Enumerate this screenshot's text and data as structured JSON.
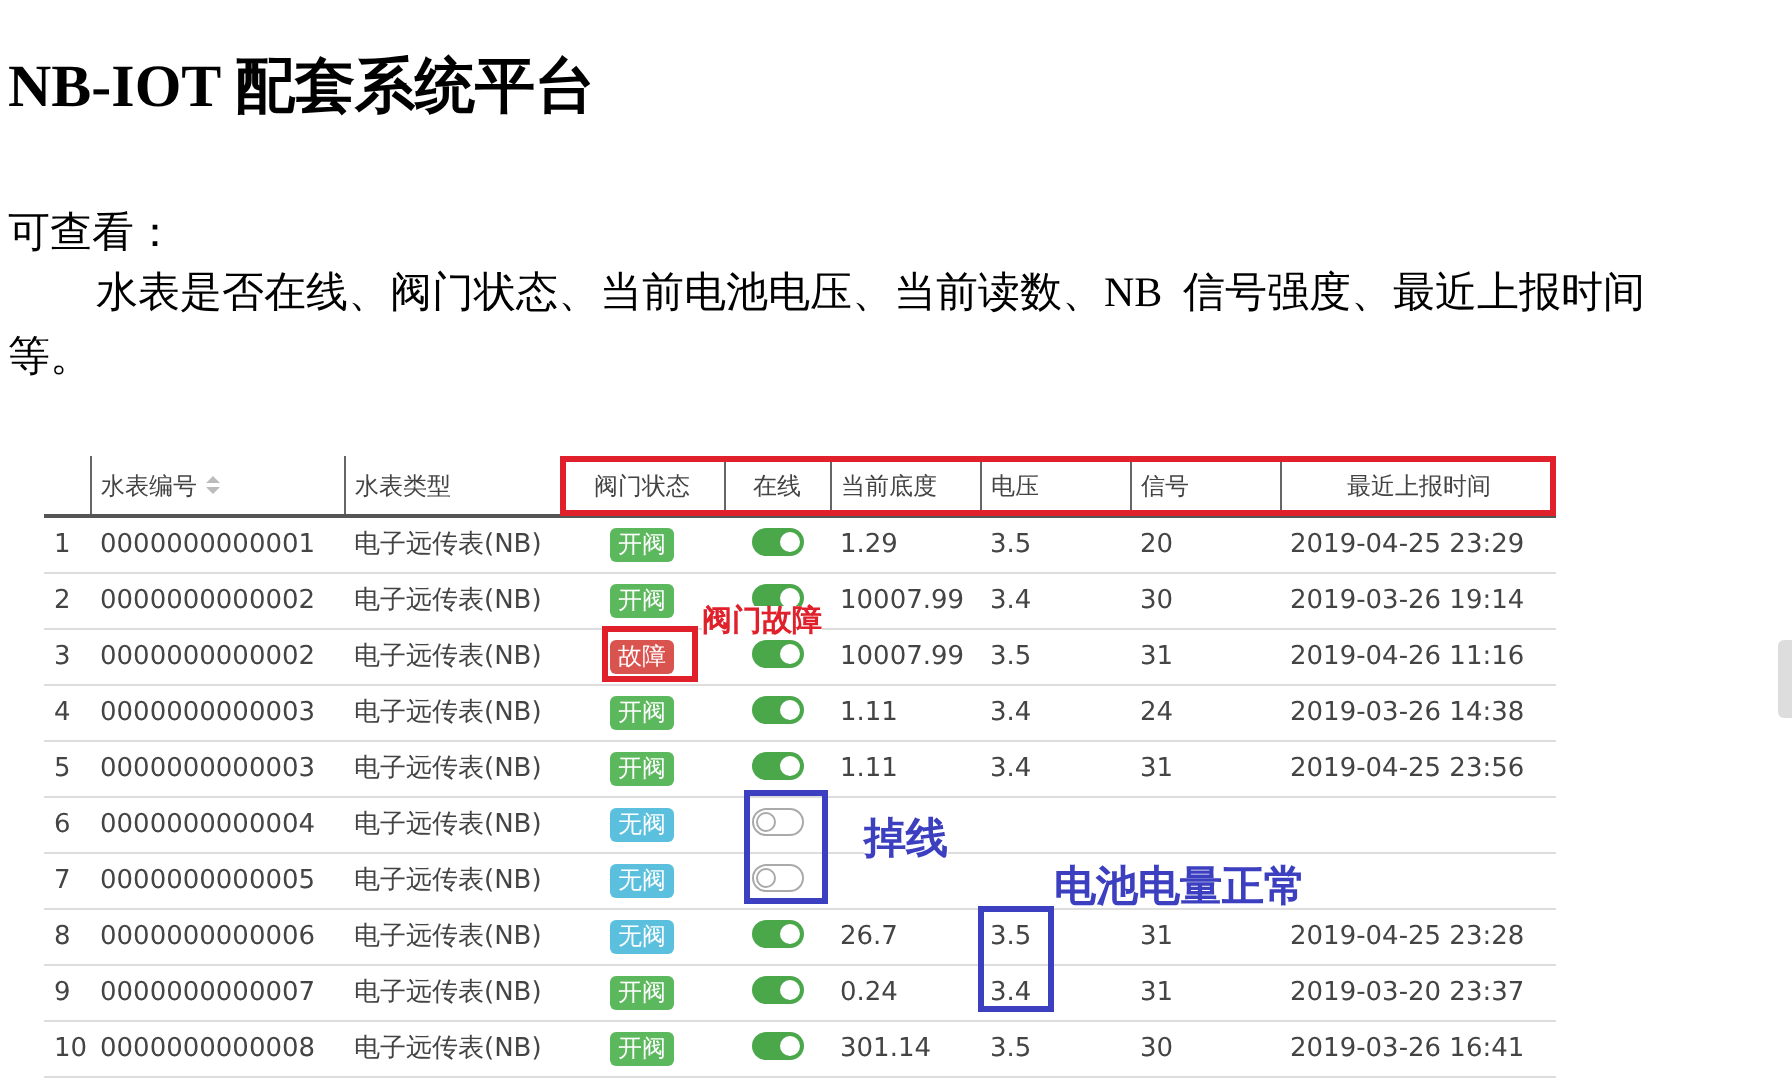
{
  "heading": "NB-IOT 配套系统平台",
  "subheading": "可查看：",
  "paragraph": "水表是否在线、阀门状态、当前电池电压、当前读数、NB  信号强度、最近上报时间等。",
  "table": {
    "columns": [
      {},
      {
        "label": "水表编号",
        "sortable": true
      },
      {
        "label": "水表类型"
      },
      {
        "label": "阀门状态"
      },
      {
        "label": "在线"
      },
      {
        "label": "当前底度"
      },
      {
        "label": "电压"
      },
      {
        "label": "信号"
      },
      {
        "label": "最近上报时间"
      }
    ],
    "rows": [
      {
        "index": "1",
        "id": "0000000000001",
        "type": "电子远传表(NB)",
        "valve": {
          "label": "开阀",
          "kind": "open"
        },
        "online": true,
        "reading": "1.29",
        "voltage": "3.5",
        "signal": "20",
        "time": "2019-04-25 23:29"
      },
      {
        "index": "2",
        "id": "0000000000002",
        "type": "电子远传表(NB)",
        "valve": {
          "label": "开阀",
          "kind": "open"
        },
        "online": true,
        "reading": "10007.99",
        "voltage": "3.4",
        "signal": "30",
        "time": "2019-03-26 19:14"
      },
      {
        "index": "3",
        "id": "0000000000002",
        "type": "电子远传表(NB)",
        "valve": {
          "label": "故障",
          "kind": "fault"
        },
        "online": true,
        "reading": "10007.99",
        "voltage": "3.5",
        "signal": "31",
        "time": "2019-04-26 11:16"
      },
      {
        "index": "4",
        "id": "0000000000003",
        "type": "电子远传表(NB)",
        "valve": {
          "label": "开阀",
          "kind": "open"
        },
        "online": true,
        "reading": "1.11",
        "voltage": "3.4",
        "signal": "24",
        "time": "2019-03-26 14:38"
      },
      {
        "index": "5",
        "id": "0000000000003",
        "type": "电子远传表(NB)",
        "valve": {
          "label": "开阀",
          "kind": "open"
        },
        "online": true,
        "reading": "1.11",
        "voltage": "3.4",
        "signal": "31",
        "time": "2019-04-25 23:56"
      },
      {
        "index": "6",
        "id": "0000000000004",
        "type": "电子远传表(NB)",
        "valve": {
          "label": "无阀",
          "kind": "none"
        },
        "online": false,
        "reading": "",
        "voltage": "",
        "signal": "",
        "time": ""
      },
      {
        "index": "7",
        "id": "0000000000005",
        "type": "电子远传表(NB)",
        "valve": {
          "label": "无阀",
          "kind": "none"
        },
        "online": false,
        "reading": "",
        "voltage": "",
        "signal": "",
        "time": ""
      },
      {
        "index": "8",
        "id": "0000000000006",
        "type": "电子远传表(NB)",
        "valve": {
          "label": "无阀",
          "kind": "none"
        },
        "online": true,
        "reading": "26.7",
        "voltage": "3.5",
        "signal": "31",
        "time": "2019-04-25 23:28"
      },
      {
        "index": "9",
        "id": "0000000000007",
        "type": "电子远传表(NB)",
        "valve": {
          "label": "开阀",
          "kind": "open"
        },
        "online": true,
        "reading": "0.24",
        "voltage": "3.4",
        "signal": "31",
        "time": "2019-03-20 23:37"
      },
      {
        "index": "10",
        "id": "0000000000008",
        "type": "电子远传表(NB)",
        "valve": {
          "label": "开阀",
          "kind": "open"
        },
        "online": true,
        "reading": "301.14",
        "voltage": "3.5",
        "signal": "30",
        "time": "2019-03-26 16:41"
      }
    ]
  },
  "annotations": [
    {
      "kind": "box",
      "color": "#e0202a"
    },
    {
      "kind": "box",
      "color": "#e0202a"
    },
    {
      "kind": "label",
      "text": "阀门故障",
      "color": "#e0202a"
    },
    {
      "kind": "box",
      "color": "#3b3fc0"
    },
    {
      "kind": "label",
      "text": "掉线",
      "color": "#3b3fc0"
    },
    {
      "kind": "label",
      "text": "电池电量正常",
      "color": "#3b3fc0"
    },
    {
      "kind": "box",
      "color": "#3b3fc0"
    }
  ]
}
